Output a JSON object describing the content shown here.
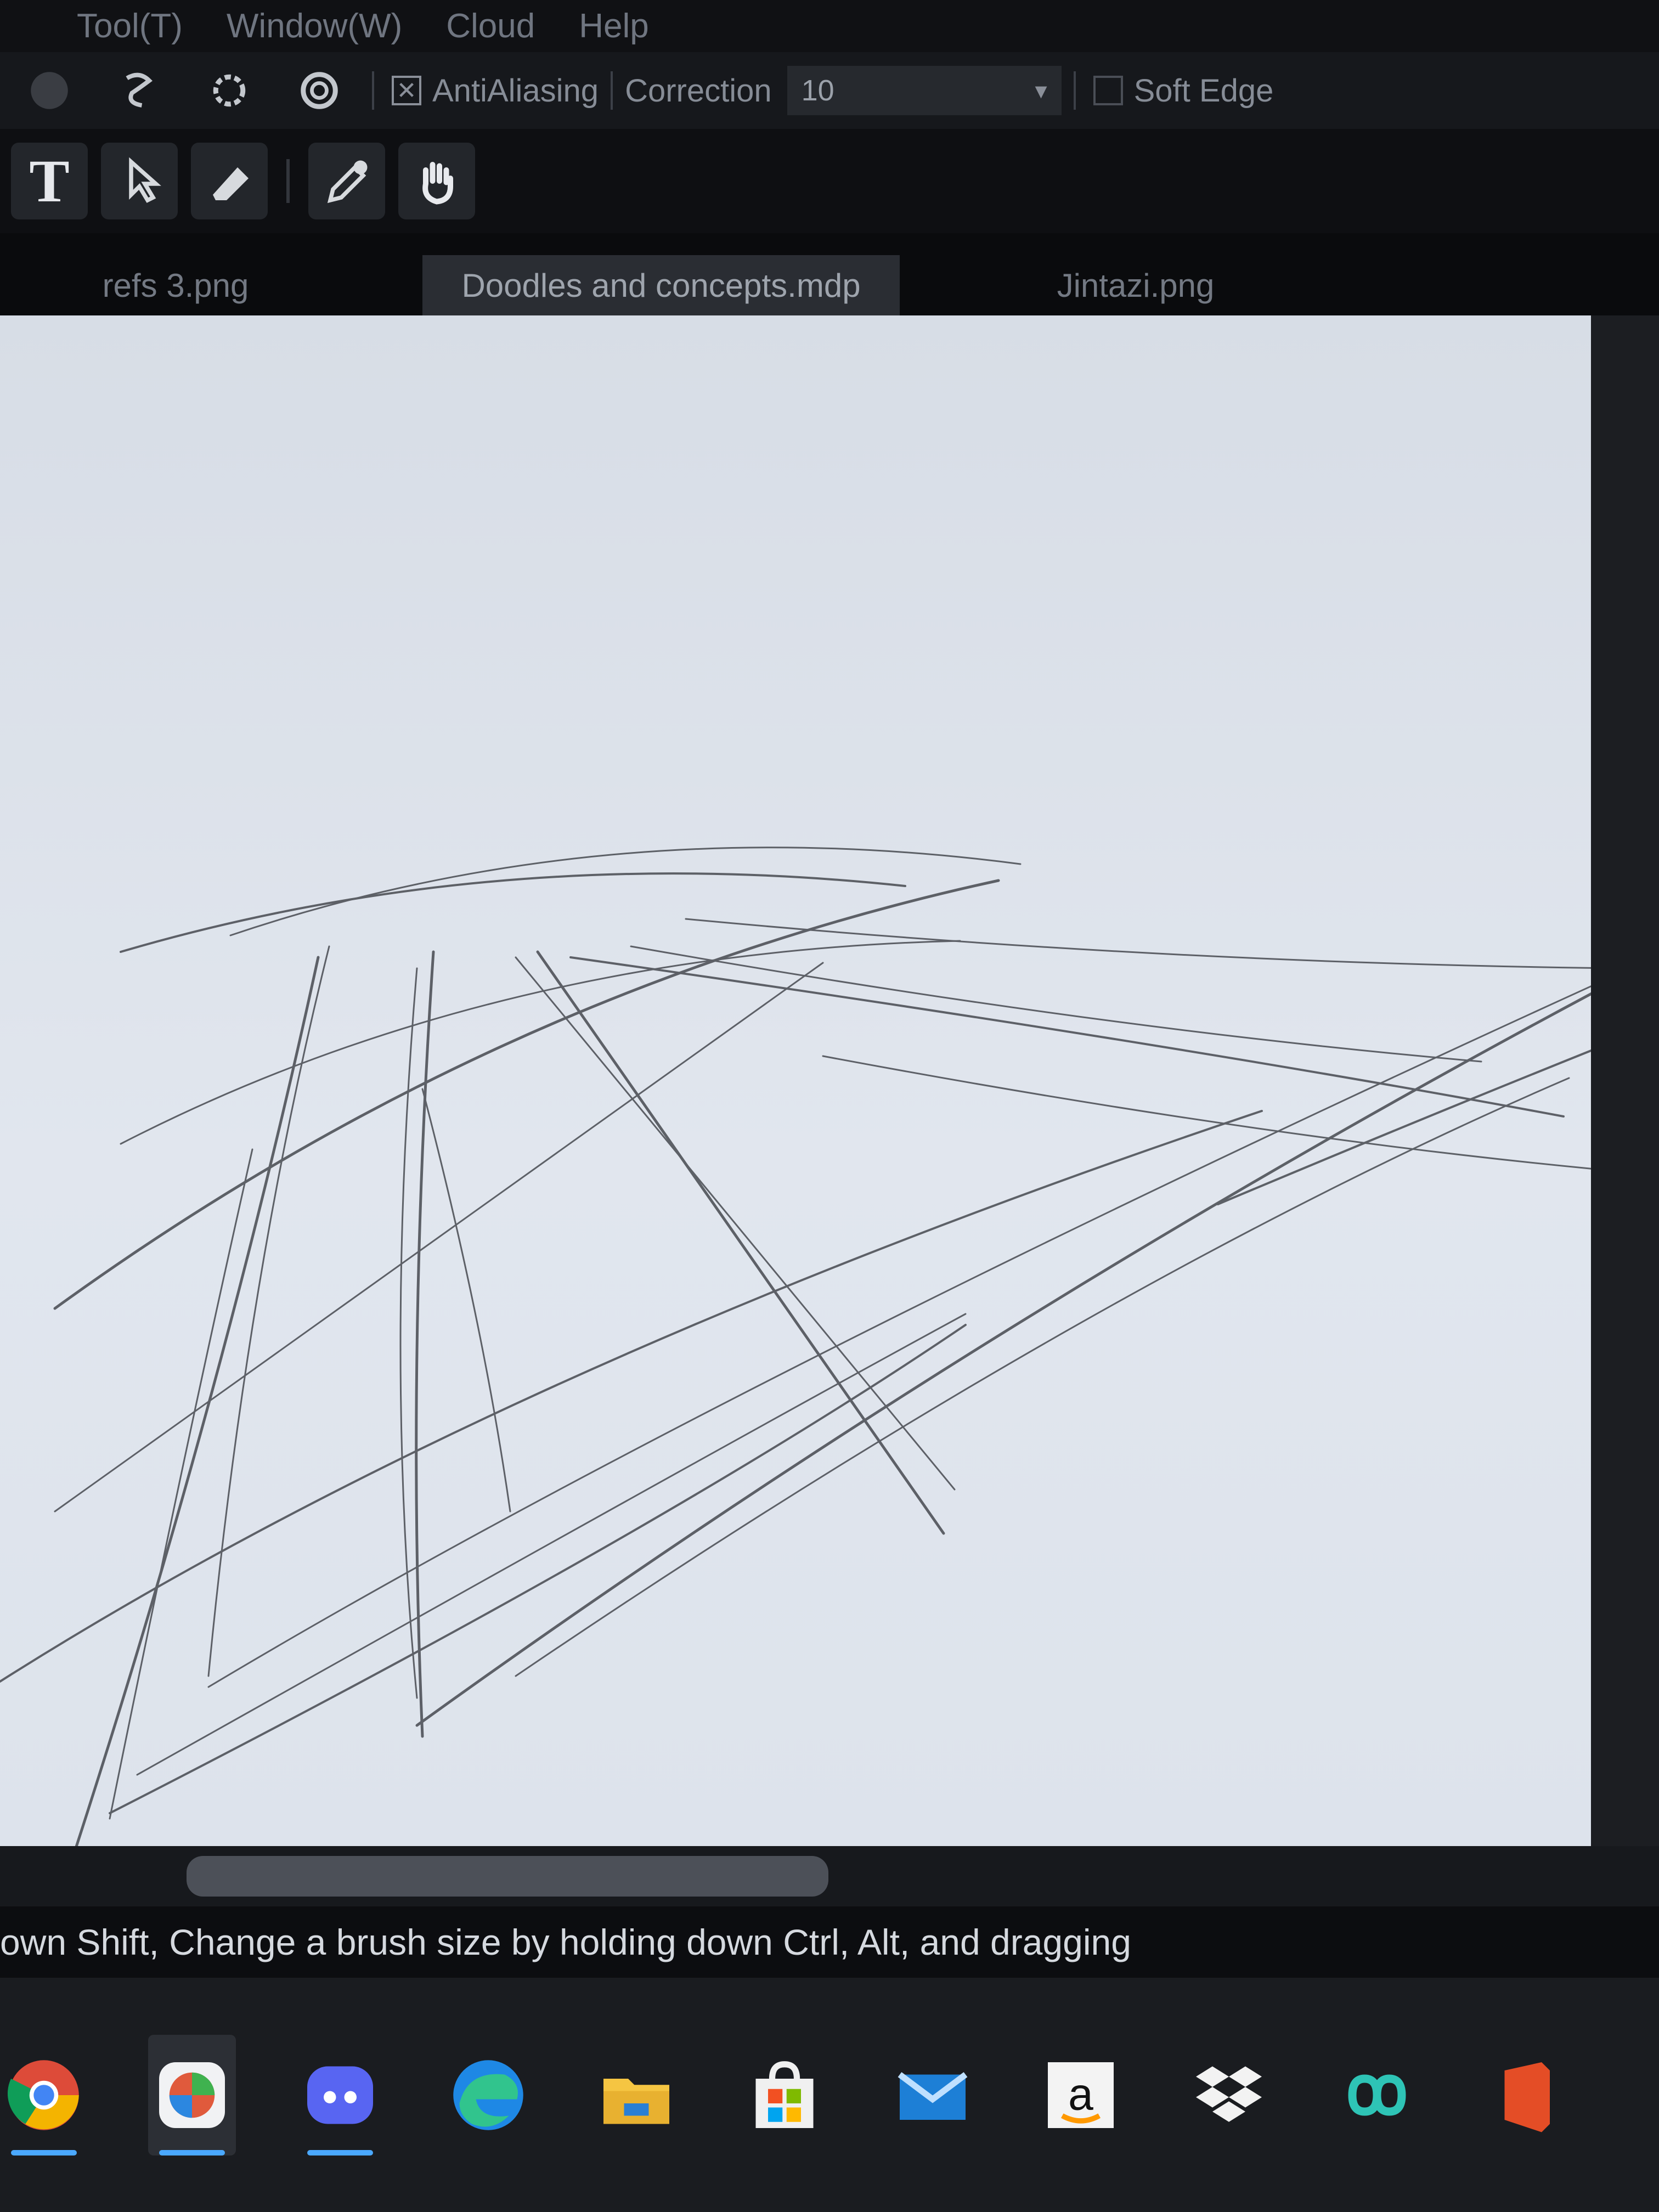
{
  "menu": {
    "items": [
      "Tool(T)",
      "Window(W)",
      "Cloud",
      "Help"
    ]
  },
  "options": {
    "antialiasing_label": "AntiAliasing",
    "correction_label": "Correction",
    "correction_value": "10",
    "soft_edge_label": "Soft Edge"
  },
  "tools": {
    "text_glyph": "T"
  },
  "tabs": [
    {
      "label": "refs 3.png"
    },
    {
      "label": "Doodles and concepts.mdp"
    },
    {
      "label": "Jintazi.png"
    }
  ],
  "status": {
    "hint": "own Shift, Change a brush size by holding down Ctrl, Alt, and dragging"
  },
  "taskbar": {
    "apps": [
      "chrome-icon",
      "medibang-icon",
      "discord-icon",
      "edge-icon",
      "file-explorer-icon",
      "store-icon",
      "mail-icon",
      "amazon-icon",
      "dropbox-icon",
      "infinity-icon",
      "office-icon"
    ],
    "amazon_glyph": "a"
  },
  "colors": {
    "canvas": "#dfe4ec",
    "stroke": "#3d4046",
    "ui_dark": "#101114",
    "accent": "#4aa8ff"
  }
}
